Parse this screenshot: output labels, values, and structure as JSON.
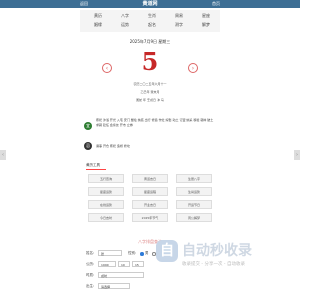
{
  "header": {
    "back": "返回",
    "title": "黄道网",
    "home": "首页"
  },
  "nav": [
    "黄历",
    "八字",
    "生肖",
    "周易",
    "星座",
    "姻缘",
    "运势",
    "起名",
    "测字",
    "解梦"
  ],
  "date": {
    "head": "2025年7月9日 星期三",
    "day": "5",
    "lunar": "农历二〇二五年六月十一",
    "ganzhi": "乙巳年 癸未月",
    "extra": "属蛇 年 壬戌日 冲 马",
    "prev_icon": "chevron-left-icon",
    "next_icon": "chevron-right-icon"
  },
  "yiji": {
    "yi_label": "宜",
    "yi_text": "祭祀 沐浴 开光 入宅 安门 塑绘 纳畜 出行 修造 作灶 嫁娶 动土 订盟 纳采 移徙 栽种 破土 求嗣 赴任 会亲友 开市 立券",
    "ji_label": "忌",
    "ji_text": "诸事 开仓 祭祀 造桥 修坟"
  },
  "tools": {
    "title": "黄历工具",
    "items": [
      "五行查询",
      "黄道吉日",
      "生辰八字",
      "星座运势",
      "星座运程",
      "生肖运势",
      "在线运势",
      "开业吉日",
      "开运节日",
      "今日吉时",
      "2025年节气",
      "周公解梦"
    ]
  },
  "form": {
    "title": "八字排盘查询",
    "name_label": "姓名:",
    "name_value": "张",
    "gender_label": "性别:",
    "male": "男",
    "female": "女",
    "birth_label": "公历:",
    "year": "1990",
    "month": "10",
    "day": "15",
    "time_label": "时辰:",
    "time_value": "戌时",
    "place_label": "出生:",
    "place_value": "请选择"
  },
  "watermark": {
    "logo": "自",
    "big": "自动秒收录",
    "small": "收录提交 - 分享一次 - 自动收录"
  }
}
